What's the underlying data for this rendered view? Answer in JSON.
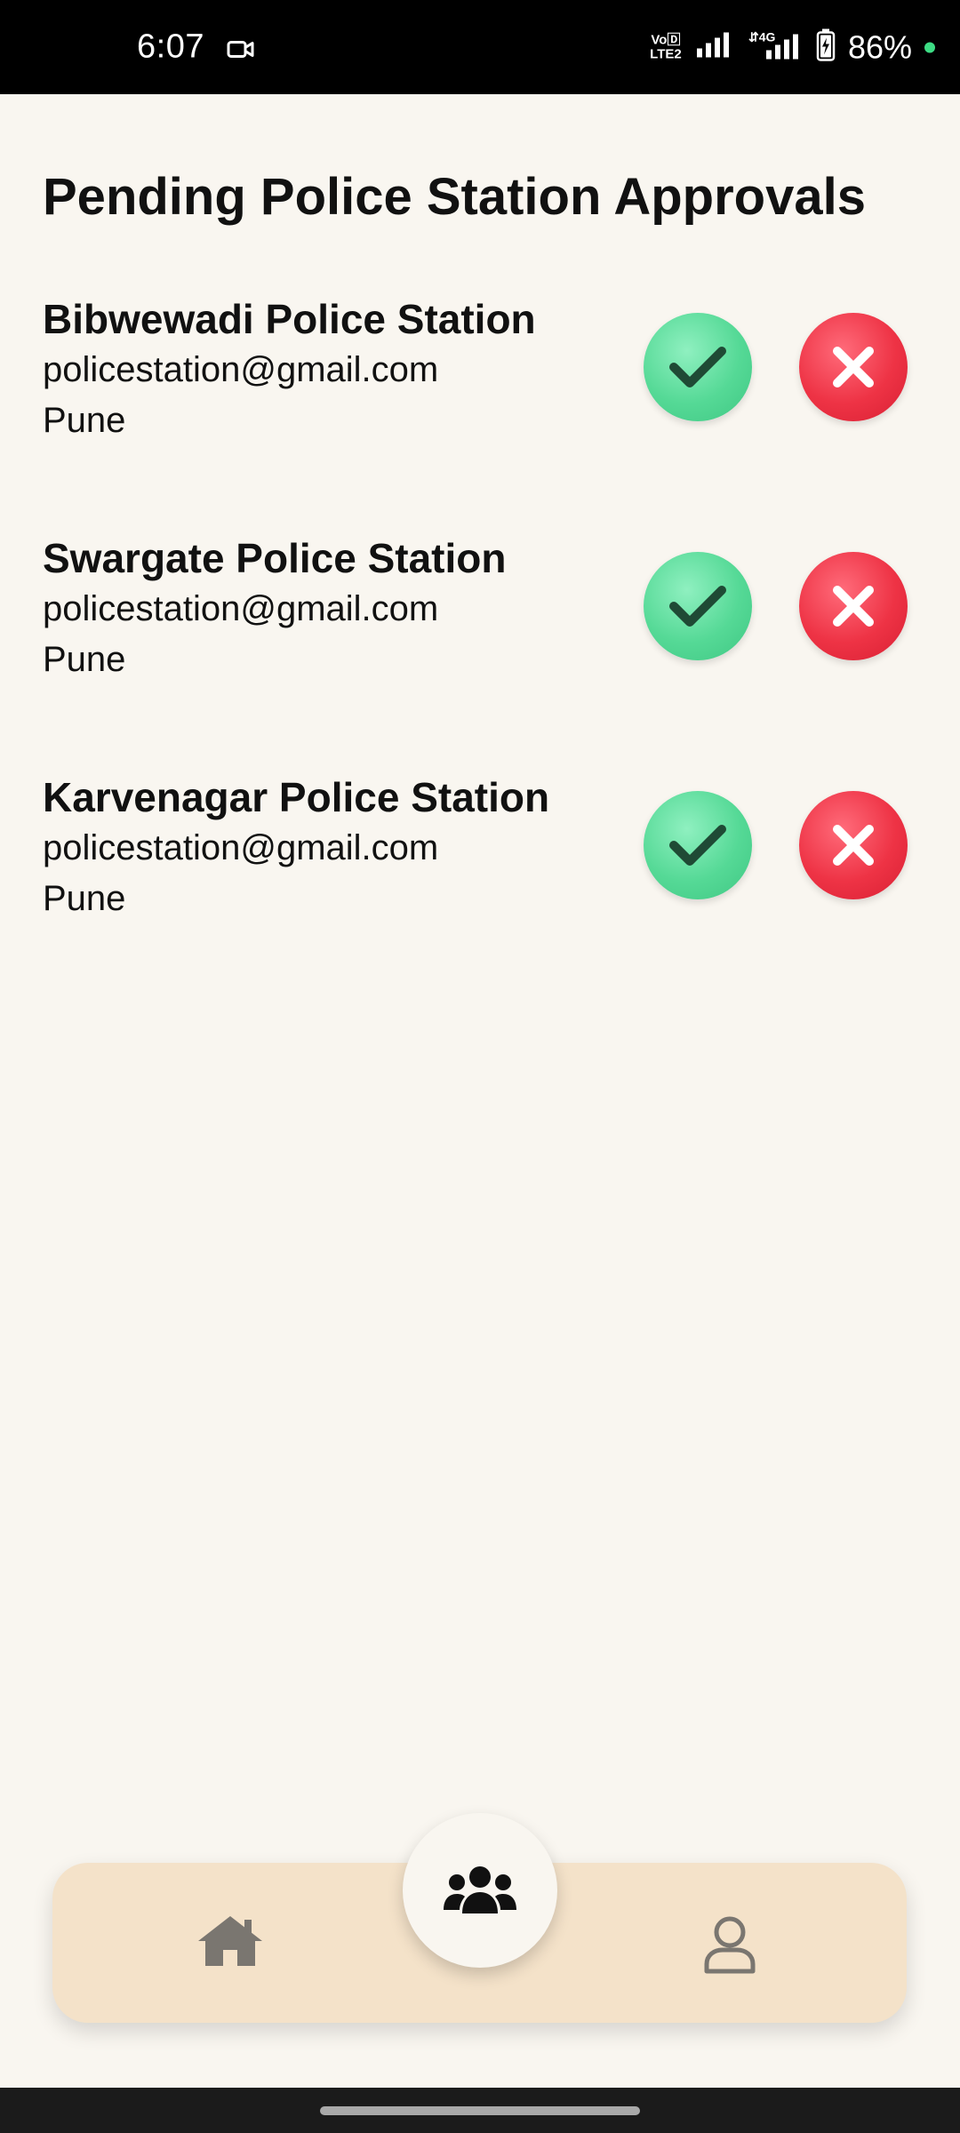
{
  "status_bar": {
    "time": "6:07",
    "network_label": "VoLTE2",
    "network_type": "4G",
    "battery": "86%"
  },
  "page": {
    "title": "Pending Police Station Approvals"
  },
  "stations": [
    {
      "name": "Bibwewadi Police Station",
      "email": "policestation@gmail.com",
      "city": "Pune"
    },
    {
      "name": "Swargate Police Station",
      "email": "policestation@gmail.com",
      "city": "Pune"
    },
    {
      "name": "Karvenagar Police Station",
      "email": "policestation@gmail.com",
      "city": "Pune"
    }
  ],
  "icons": {
    "approve": "check-icon",
    "reject": "close-icon",
    "home": "home-icon",
    "group": "users-icon",
    "profile": "user-icon"
  },
  "colors": {
    "approve": "#55d996",
    "reject": "#ee3345",
    "nav_background": "#f4e2c9",
    "page_background": "#f9f6f0"
  }
}
